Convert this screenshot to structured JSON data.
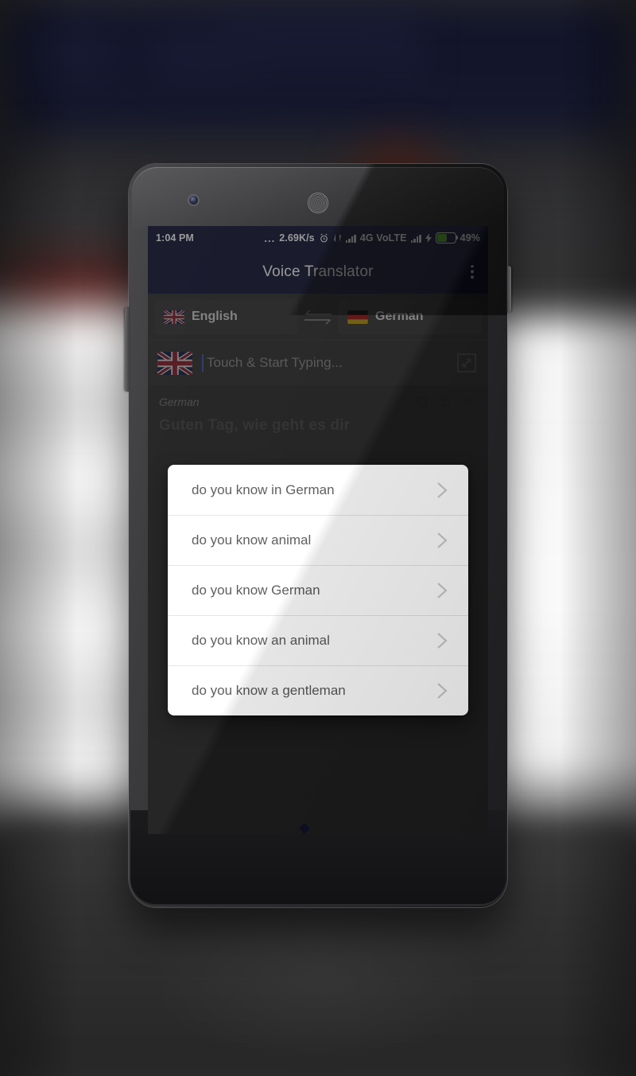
{
  "background": {
    "description": "blurred app screenshot backdrop",
    "top_color": "#14162c",
    "bottom_color": "#2b2b2b"
  },
  "device": {
    "name": "android-phone-mockup",
    "frame_color": "#2e2e30"
  },
  "status_bar": {
    "time": "1:04 PM",
    "dots": "...",
    "network_speed": "2.69K/s",
    "alarm_icon": "alarm-clock-icon",
    "vibrate_icon": "vibrate-icon",
    "signal_icon_1": "signal-bars-icon",
    "network_type": "4G VoLTE",
    "signal_icon_2": "signal-bars-icon",
    "charging_icon": "charging-bolt-icon",
    "battery_percent": "49%",
    "battery_level": 49,
    "battery_color": "#5ec42b",
    "background_color": "#1b1e3e"
  },
  "app_bar": {
    "title": "Voice Translator",
    "overflow_menu": "more-options-icon"
  },
  "language_bar": {
    "source": {
      "flag": "uk-flag-icon",
      "label": "English"
    },
    "swap": "swap-languages-icon",
    "target": {
      "flag": "germany-flag-icon",
      "label": "German"
    }
  },
  "input_row": {
    "flag": "uk-flag-icon",
    "placeholder": "Touch & Start Typing...",
    "value": "",
    "expand_button": "expand-fullscreen-icon"
  },
  "suggestions": {
    "items": [
      {
        "text": "do you know in German",
        "chevron": "chevron-right-icon"
      },
      {
        "text": "do you know animal",
        "chevron": "chevron-right-icon"
      },
      {
        "text": "do you know German",
        "chevron": "chevron-right-icon"
      },
      {
        "text": "do you know an animal",
        "chevron": "chevron-right-icon"
      },
      {
        "text": "do you know a gentleman",
        "chevron": "chevron-right-icon"
      }
    ]
  },
  "result_card": {
    "language_label": "German",
    "text": "Guten Tag, wie geht es dir",
    "actions": [
      "copy-icon",
      "share-icon",
      "speaker-icon"
    ]
  }
}
